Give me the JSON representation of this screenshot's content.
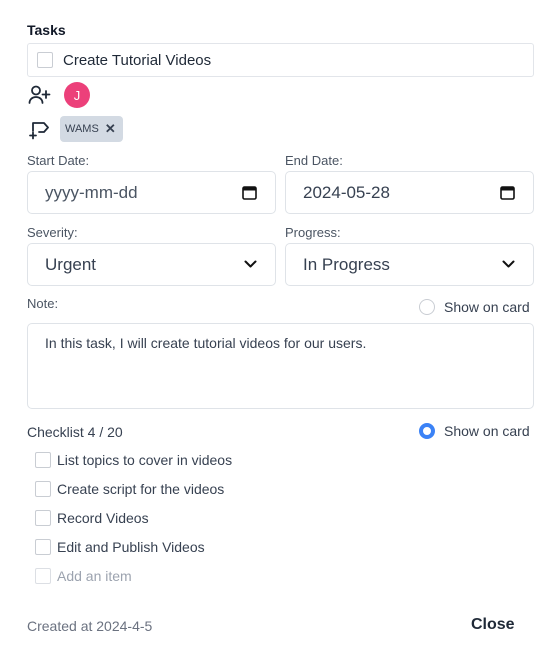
{
  "section_title": "Tasks",
  "task": {
    "name": "Create Tutorial Videos"
  },
  "assignee": {
    "initial": "J",
    "color": "#ec407a"
  },
  "labels": [
    {
      "text": "WAMS"
    }
  ],
  "start_date": {
    "label": "Start Date:",
    "placeholder": "yyyy-mm-dd"
  },
  "end_date": {
    "label": "End Date:",
    "value": "2024-05-28"
  },
  "severity": {
    "label": "Severity:",
    "value": "Urgent"
  },
  "progress": {
    "label": "Progress:",
    "value": "In Progress"
  },
  "note": {
    "label": "Note:",
    "show_on_card_label": "Show on card",
    "show_on_card": false,
    "text": "In this task, I will create tutorial videos for our users."
  },
  "checklist": {
    "title": "Checklist 4 / 20",
    "show_on_card_label": "Show on card",
    "show_on_card": true,
    "items": [
      {
        "label": "List topics to cover in videos",
        "checked": false
      },
      {
        "label": "Create script for the videos",
        "checked": false
      },
      {
        "label": "Record Videos",
        "checked": false
      },
      {
        "label": "Edit and Publish Videos",
        "checked": false
      }
    ],
    "add_placeholder": "Add an item"
  },
  "footer": {
    "created": "Created at 2024-4-5",
    "close_label": "Close"
  },
  "colors": {
    "accent": "#3b82f6",
    "tag_bg": "#d3dae3"
  },
  "icons": {
    "assign": "add-user-icon",
    "label": "add-label-icon",
    "calendar": "calendar-icon",
    "dropdown": "chevron-down-icon",
    "remove": "close-icon"
  }
}
